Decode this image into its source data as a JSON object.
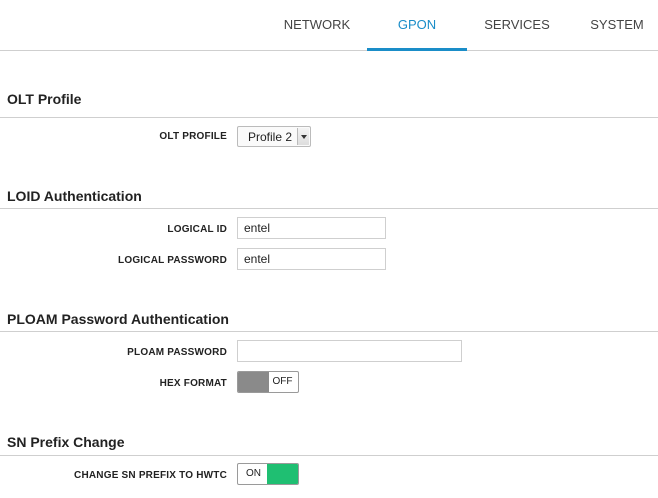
{
  "nav": {
    "tabs": [
      {
        "label": "NETWORK",
        "active": false
      },
      {
        "label": "GPON",
        "active": true
      },
      {
        "label": "SERVICES",
        "active": false
      },
      {
        "label": "SYSTEM",
        "active": false
      }
    ],
    "accent_color": "#1a8dc8"
  },
  "sections": {
    "olt": {
      "title": "OLT Profile",
      "olt_profile": {
        "label": "OLT PROFILE",
        "value": "Profile 2"
      }
    },
    "loid": {
      "title": "LOID Authentication",
      "logical_id": {
        "label": "LOGICAL ID",
        "value": "entel"
      },
      "logical_password": {
        "label": "LOGICAL PASSWORD",
        "value": "entel"
      }
    },
    "ploam": {
      "title": "PLOAM Password Authentication",
      "ploam_password": {
        "label": "PLOAM PASSWORD",
        "value": ""
      },
      "hex_format": {
        "label": "HEX FORMAT",
        "state_text": "OFF",
        "on": false,
        "color": "#8a8a8a"
      }
    },
    "sn": {
      "title": "SN Prefix Change",
      "change_sn_prefix": {
        "label": "CHANGE SN PREFIX TO HWTC",
        "state_text": "ON",
        "on": true,
        "color": "#1fbf72"
      }
    }
  }
}
